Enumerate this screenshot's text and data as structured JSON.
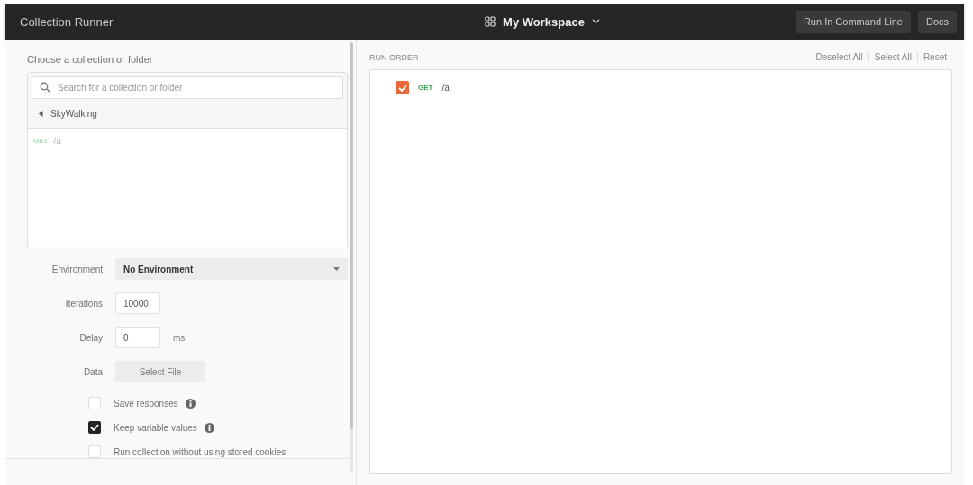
{
  "header": {
    "title": "Collection Runner",
    "workspace": "My Workspace",
    "buttons": [
      "Run In Command Line",
      "Docs"
    ]
  },
  "chooser": {
    "label": "Choose a collection or folder",
    "search": {
      "placeholder": "Search for a collection or folder"
    },
    "breadcrumb": "SkyWalking",
    "requests": [
      {
        "method": "GET",
        "path": "/a"
      }
    ]
  },
  "settings": {
    "environment": {
      "label": "Environment",
      "value": "No Environment"
    },
    "iterations": {
      "label": "Iterations",
      "value": "10000"
    },
    "delay": {
      "label": "Delay",
      "value": "0",
      "unit": "ms"
    },
    "data": {
      "label": "Data",
      "button": "Select File"
    }
  },
  "options": [
    {
      "label": "Save responses",
      "checked": false,
      "info": true
    },
    {
      "label": "Keep variable values",
      "checked": true,
      "info": true
    },
    {
      "label": "Run collection without using stored cookies",
      "checked": false,
      "info": false
    }
  ],
  "run_order": {
    "title": "RUN ORDER",
    "actions": [
      "Deselect All",
      "Select All",
      "Reset"
    ],
    "items": [
      {
        "method": "GET",
        "path": "/a",
        "checked": true
      }
    ]
  }
}
